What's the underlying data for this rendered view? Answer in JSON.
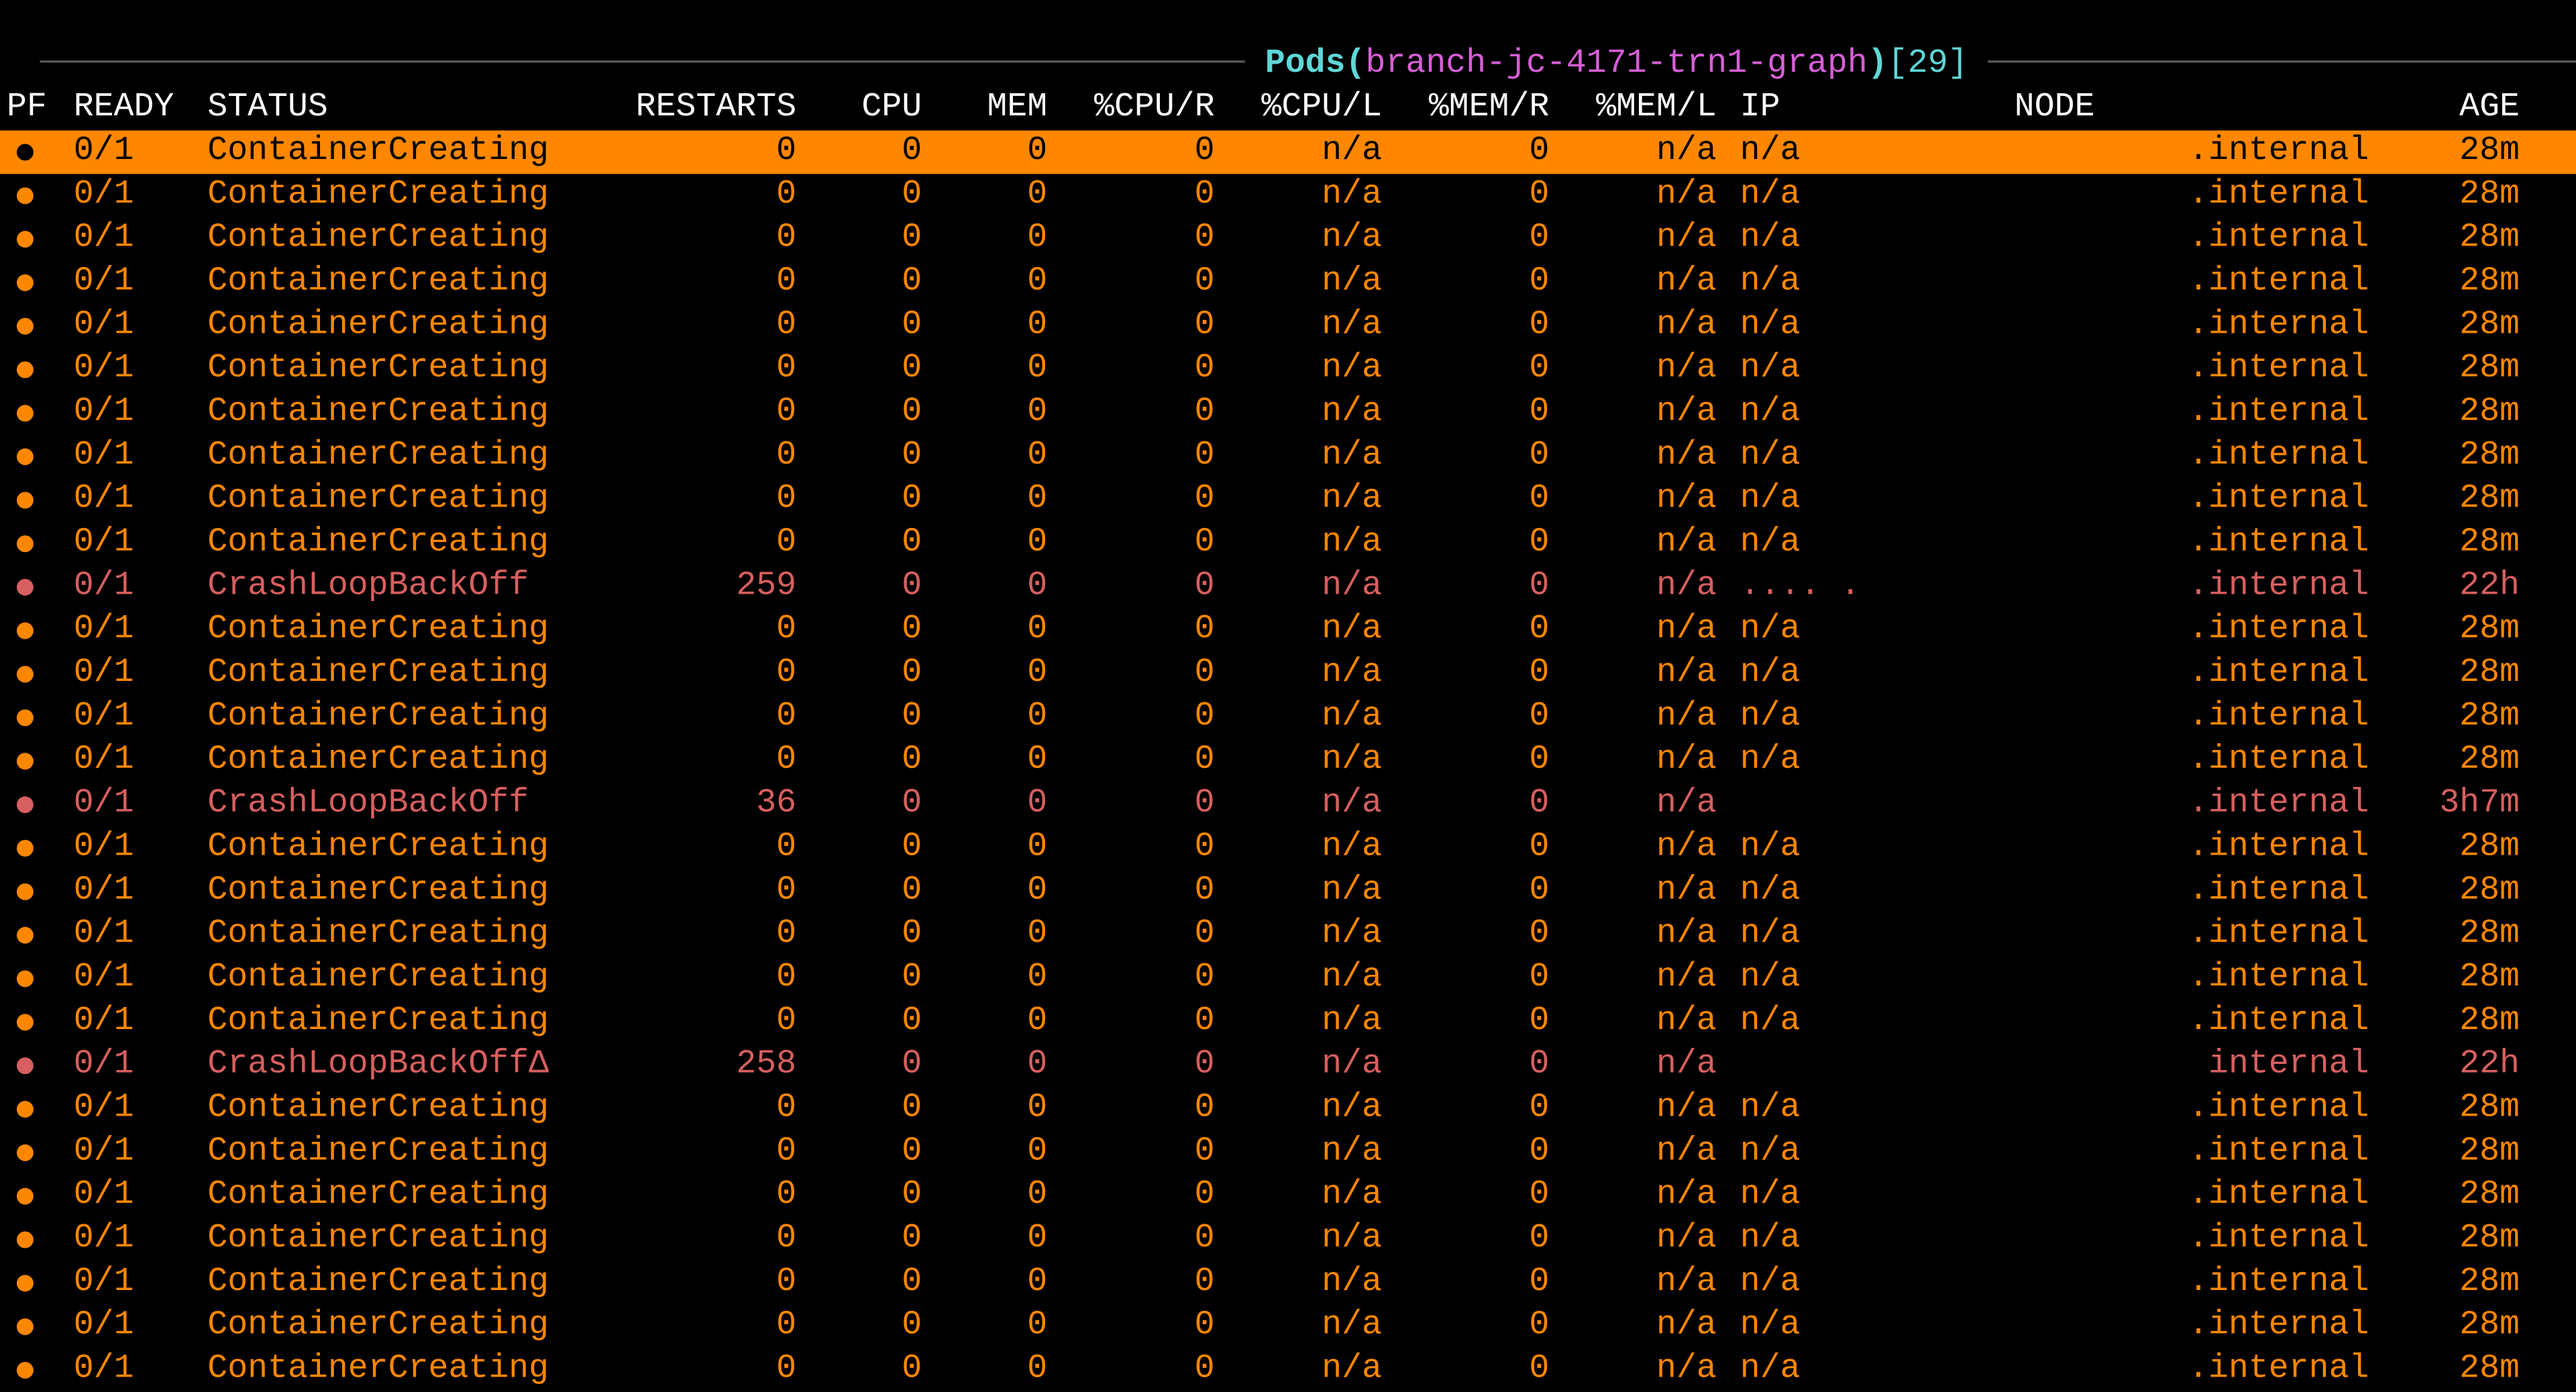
{
  "title": {
    "label": "Pods",
    "namespace": "branch-jc-4171-trn1-graph",
    "count": "[29]"
  },
  "columns": {
    "pf": "PF",
    "ready": "READY",
    "status": "STATUS",
    "restarts": "RESTARTS",
    "cpu": "CPU",
    "mem": "MEM",
    "cpur": "%CPU/R",
    "cpul": "%CPU/L",
    "memr": "%MEM/R",
    "meml": "%MEM/L",
    "ip": "IP",
    "node": "NODE",
    "age": "AGE"
  },
  "rows": [
    {
      "pf": "●",
      "ready": "0/1",
      "status": "ContainerCreating",
      "restarts": "0",
      "cpu": "0",
      "mem": "0",
      "cpur": "0",
      "cpul": "n/a",
      "memr": "0",
      "meml": "n/a",
      "ip": "n/a",
      "node": ".internal",
      "age": "28m",
      "kind": "selected"
    },
    {
      "pf": "●",
      "ready": "0/1",
      "status": "ContainerCreating",
      "restarts": "0",
      "cpu": "0",
      "mem": "0",
      "cpur": "0",
      "cpul": "n/a",
      "memr": "0",
      "meml": "n/a",
      "ip": "n/a",
      "node": ".internal",
      "age": "28m",
      "kind": "normal"
    },
    {
      "pf": "●",
      "ready": "0/1",
      "status": "ContainerCreating",
      "restarts": "0",
      "cpu": "0",
      "mem": "0",
      "cpur": "0",
      "cpul": "n/a",
      "memr": "0",
      "meml": "n/a",
      "ip": "n/a",
      "node": ".internal",
      "age": "28m",
      "kind": "normal"
    },
    {
      "pf": "●",
      "ready": "0/1",
      "status": "ContainerCreating",
      "restarts": "0",
      "cpu": "0",
      "mem": "0",
      "cpur": "0",
      "cpul": "n/a",
      "memr": "0",
      "meml": "n/a",
      "ip": "n/a",
      "node": ".internal",
      "age": "28m",
      "kind": "normal"
    },
    {
      "pf": "●",
      "ready": "0/1",
      "status": "ContainerCreating",
      "restarts": "0",
      "cpu": "0",
      "mem": "0",
      "cpur": "0",
      "cpul": "n/a",
      "memr": "0",
      "meml": "n/a",
      "ip": "n/a",
      "node": ".internal",
      "age": "28m",
      "kind": "normal"
    },
    {
      "pf": "●",
      "ready": "0/1",
      "status": "ContainerCreating",
      "restarts": "0",
      "cpu": "0",
      "mem": "0",
      "cpur": "0",
      "cpul": "n/a",
      "memr": "0",
      "meml": "n/a",
      "ip": "n/a",
      "node": ".internal",
      "age": "28m",
      "kind": "normal"
    },
    {
      "pf": "●",
      "ready": "0/1",
      "status": "ContainerCreating",
      "restarts": "0",
      "cpu": "0",
      "mem": "0",
      "cpur": "0",
      "cpul": "n/a",
      "memr": "0",
      "meml": "n/a",
      "ip": "n/a",
      "node": ".internal",
      "age": "28m",
      "kind": "normal"
    },
    {
      "pf": "●",
      "ready": "0/1",
      "status": "ContainerCreating",
      "restarts": "0",
      "cpu": "0",
      "mem": "0",
      "cpur": "0",
      "cpul": "n/a",
      "memr": "0",
      "meml": "n/a",
      "ip": "n/a",
      "node": ".internal",
      "age": "28m",
      "kind": "normal"
    },
    {
      "pf": "●",
      "ready": "0/1",
      "status": "ContainerCreating",
      "restarts": "0",
      "cpu": "0",
      "mem": "0",
      "cpur": "0",
      "cpul": "n/a",
      "memr": "0",
      "meml": "n/a",
      "ip": "n/a",
      "node": ".internal",
      "age": "28m",
      "kind": "normal"
    },
    {
      "pf": "●",
      "ready": "0/1",
      "status": "ContainerCreating",
      "restarts": "0",
      "cpu": "0",
      "mem": "0",
      "cpur": "0",
      "cpul": "n/a",
      "memr": "0",
      "meml": "n/a",
      "ip": "n/a",
      "node": ".internal",
      "age": "28m",
      "kind": "normal"
    },
    {
      "pf": "●",
      "ready": "0/1",
      "status": "CrashLoopBackOff",
      "restarts": "259",
      "cpu": "0",
      "mem": "0",
      "cpur": "0",
      "cpul": "n/a",
      "memr": "0",
      "meml": "n/a",
      "ip": " .... .",
      "node": ".internal",
      "age": "22h",
      "kind": "crash"
    },
    {
      "pf": "●",
      "ready": "0/1",
      "status": "ContainerCreating",
      "restarts": "0",
      "cpu": "0",
      "mem": "0",
      "cpur": "0",
      "cpul": "n/a",
      "memr": "0",
      "meml": "n/a",
      "ip": "n/a",
      "node": ".internal",
      "age": "28m",
      "kind": "normal"
    },
    {
      "pf": "●",
      "ready": "0/1",
      "status": "ContainerCreating",
      "restarts": "0",
      "cpu": "0",
      "mem": "0",
      "cpur": "0",
      "cpul": "n/a",
      "memr": "0",
      "meml": "n/a",
      "ip": "n/a",
      "node": ".internal",
      "age": "28m",
      "kind": "normal"
    },
    {
      "pf": "●",
      "ready": "0/1",
      "status": "ContainerCreating",
      "restarts": "0",
      "cpu": "0",
      "mem": "0",
      "cpur": "0",
      "cpul": "n/a",
      "memr": "0",
      "meml": "n/a",
      "ip": "n/a",
      "node": ".internal",
      "age": "28m",
      "kind": "normal"
    },
    {
      "pf": "●",
      "ready": "0/1",
      "status": "ContainerCreating",
      "restarts": "0",
      "cpu": "0",
      "mem": "0",
      "cpur": "0",
      "cpul": "n/a",
      "memr": "0",
      "meml": "n/a",
      "ip": "n/a",
      "node": ".internal",
      "age": "28m",
      "kind": "normal"
    },
    {
      "pf": "●",
      "ready": "0/1",
      "status": "CrashLoopBackOff",
      "restarts": "36",
      "cpu": "0",
      "mem": "0",
      "cpur": "0",
      "cpul": "n/a",
      "memr": "0",
      "meml": "n/a",
      "ip": "",
      "node": ".internal",
      "age": "3h7m",
      "kind": "crash"
    },
    {
      "pf": "●",
      "ready": "0/1",
      "status": "ContainerCreating",
      "restarts": "0",
      "cpu": "0",
      "mem": "0",
      "cpur": "0",
      "cpul": "n/a",
      "memr": "0",
      "meml": "n/a",
      "ip": "n/a",
      "node": ".internal",
      "age": "28m",
      "kind": "normal"
    },
    {
      "pf": "●",
      "ready": "0/1",
      "status": "ContainerCreating",
      "restarts": "0",
      "cpu": "0",
      "mem": "0",
      "cpur": "0",
      "cpul": "n/a",
      "memr": "0",
      "meml": "n/a",
      "ip": "n/a",
      "node": ".internal",
      "age": "28m",
      "kind": "normal"
    },
    {
      "pf": "●",
      "ready": "0/1",
      "status": "ContainerCreating",
      "restarts": "0",
      "cpu": "0",
      "mem": "0",
      "cpur": "0",
      "cpul": "n/a",
      "memr": "0",
      "meml": "n/a",
      "ip": "n/a",
      "node": ".internal",
      "age": "28m",
      "kind": "normal"
    },
    {
      "pf": "●",
      "ready": "0/1",
      "status": "ContainerCreating",
      "restarts": "0",
      "cpu": "0",
      "mem": "0",
      "cpur": "0",
      "cpul": "n/a",
      "memr": "0",
      "meml": "n/a",
      "ip": "n/a",
      "node": ".internal",
      "age": "28m",
      "kind": "normal"
    },
    {
      "pf": "●",
      "ready": "0/1",
      "status": "ContainerCreating",
      "restarts": "0",
      "cpu": "0",
      "mem": "0",
      "cpur": "0",
      "cpul": "n/a",
      "memr": "0",
      "meml": "n/a",
      "ip": "n/a",
      "node": ".internal",
      "age": "28m",
      "kind": "normal"
    },
    {
      "pf": "●",
      "ready": "0/1",
      "status": "CrashLoopBackOffΔ",
      "restarts": "258",
      "cpu": "0",
      "mem": "0",
      "cpur": "0",
      "cpul": "n/a",
      "memr": "0",
      "meml": "n/a",
      "ip": "",
      "node": "internal",
      "age": "22h",
      "kind": "crash"
    },
    {
      "pf": "●",
      "ready": "0/1",
      "status": "ContainerCreating",
      "restarts": "0",
      "cpu": "0",
      "mem": "0",
      "cpur": "0",
      "cpul": "n/a",
      "memr": "0",
      "meml": "n/a",
      "ip": "n/a",
      "node": ".internal",
      "age": "28m",
      "kind": "normal"
    },
    {
      "pf": "●",
      "ready": "0/1",
      "status": "ContainerCreating",
      "restarts": "0",
      "cpu": "0",
      "mem": "0",
      "cpur": "0",
      "cpul": "n/a",
      "memr": "0",
      "meml": "n/a",
      "ip": "n/a",
      "node": ".internal",
      "age": "28m",
      "kind": "normal"
    },
    {
      "pf": "●",
      "ready": "0/1",
      "status": "ContainerCreating",
      "restarts": "0",
      "cpu": "0",
      "mem": "0",
      "cpur": "0",
      "cpul": "n/a",
      "memr": "0",
      "meml": "n/a",
      "ip": "n/a",
      "node": ".internal",
      "age": "28m",
      "kind": "normal"
    },
    {
      "pf": "●",
      "ready": "0/1",
      "status": "ContainerCreating",
      "restarts": "0",
      "cpu": "0",
      "mem": "0",
      "cpur": "0",
      "cpul": "n/a",
      "memr": "0",
      "meml": "n/a",
      "ip": "n/a",
      "node": ".internal",
      "age": "28m",
      "kind": "normal"
    },
    {
      "pf": "●",
      "ready": "0/1",
      "status": "ContainerCreating",
      "restarts": "0",
      "cpu": "0",
      "mem": "0",
      "cpur": "0",
      "cpul": "n/a",
      "memr": "0",
      "meml": "n/a",
      "ip": "n/a",
      "node": ".internal",
      "age": "28m",
      "kind": "normal"
    },
    {
      "pf": "●",
      "ready": "0/1",
      "status": "ContainerCreating",
      "restarts": "0",
      "cpu": "0",
      "mem": "0",
      "cpur": "0",
      "cpul": "n/a",
      "memr": "0",
      "meml": "n/a",
      "ip": "n/a",
      "node": ".internal",
      "age": "28m",
      "kind": "normal"
    },
    {
      "pf": "●",
      "ready": "0/1",
      "status": "ContainerCreating",
      "restarts": "0",
      "cpu": "0",
      "mem": "0",
      "cpur": "0",
      "cpul": "n/a",
      "memr": "0",
      "meml": "n/a",
      "ip": "n/a",
      "node": ".internal",
      "age": "28m",
      "kind": "normal"
    }
  ]
}
